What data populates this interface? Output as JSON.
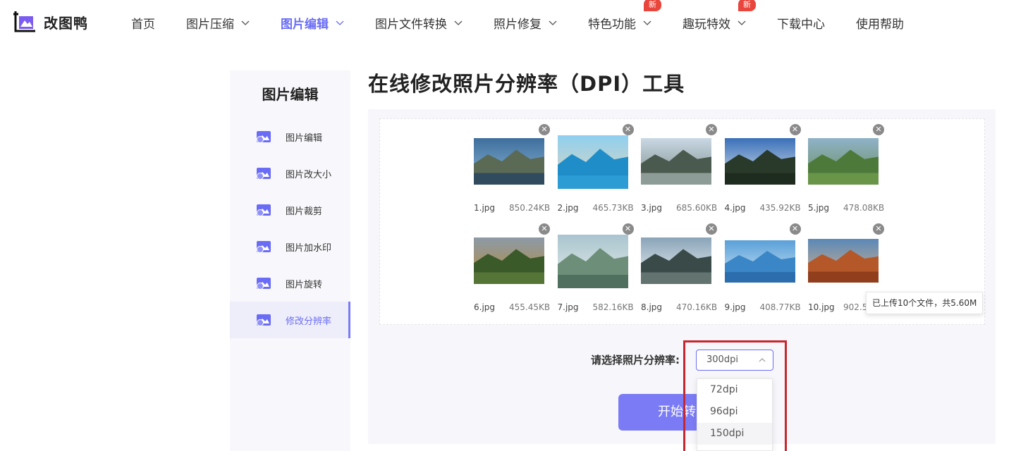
{
  "header": {
    "logo_text": "改图鸭",
    "nav": [
      {
        "label": "首页",
        "has_chevron": false,
        "active": false,
        "badge": ""
      },
      {
        "label": "图片压缩",
        "has_chevron": true,
        "active": false,
        "badge": ""
      },
      {
        "label": "图片编辑",
        "has_chevron": true,
        "active": true,
        "badge": ""
      },
      {
        "label": "图片文件转换",
        "has_chevron": true,
        "active": false,
        "badge": ""
      },
      {
        "label": "照片修复",
        "has_chevron": true,
        "active": false,
        "badge": ""
      },
      {
        "label": "特色功能",
        "has_chevron": true,
        "active": false,
        "badge": "新"
      },
      {
        "label": "趣玩特效",
        "has_chevron": true,
        "active": false,
        "badge": "新"
      },
      {
        "label": "下载中心",
        "has_chevron": false,
        "active": false,
        "badge": ""
      },
      {
        "label": "使用帮助",
        "has_chevron": false,
        "active": false,
        "badge": ""
      }
    ]
  },
  "sidebar": {
    "title": "图片编辑",
    "items": [
      {
        "label": "图片编辑",
        "icon": "image-edit-icon"
      },
      {
        "label": "图片改大小",
        "icon": "image-resize-icon"
      },
      {
        "label": "图片裁剪",
        "icon": "image-crop-icon"
      },
      {
        "label": "图片加水印",
        "icon": "image-watermark-icon"
      },
      {
        "label": "图片旋转",
        "icon": "image-rotate-icon"
      },
      {
        "label": "修改分辨率",
        "icon": "image-resolution-icon",
        "active": true
      }
    ]
  },
  "main": {
    "title": "在线修改照片分辨率（DPI）工具",
    "files": [
      {
        "name": "1.jpg",
        "size": "850.24KB"
      },
      {
        "name": "2.jpg",
        "size": "465.73KB"
      },
      {
        "name": "3.jpg",
        "size": "685.60KB"
      },
      {
        "name": "4.jpg",
        "size": "435.92KB"
      },
      {
        "name": "5.jpg",
        "size": "478.08KB"
      },
      {
        "name": "6.jpg",
        "size": "455.45KB"
      },
      {
        "name": "7.jpg",
        "size": "582.16KB"
      },
      {
        "name": "8.jpg",
        "size": "470.16KB"
      },
      {
        "name": "9.jpg",
        "size": "408.77KB"
      },
      {
        "name": "10.jpg",
        "size": "902.55"
      }
    ],
    "upload_summary": "已上传10个文件，共5.60M",
    "select_label": "请选择照片分辨率:",
    "selected_dpi": "300dpi",
    "dpi_options": [
      "72dpi",
      "96dpi",
      "150dpi"
    ],
    "start_button": "开始转"
  },
  "colors": {
    "accent": "#6a6cf6",
    "button": "#7b7cf5",
    "badge": "#e8453c",
    "highlight": "#c8262f"
  }
}
